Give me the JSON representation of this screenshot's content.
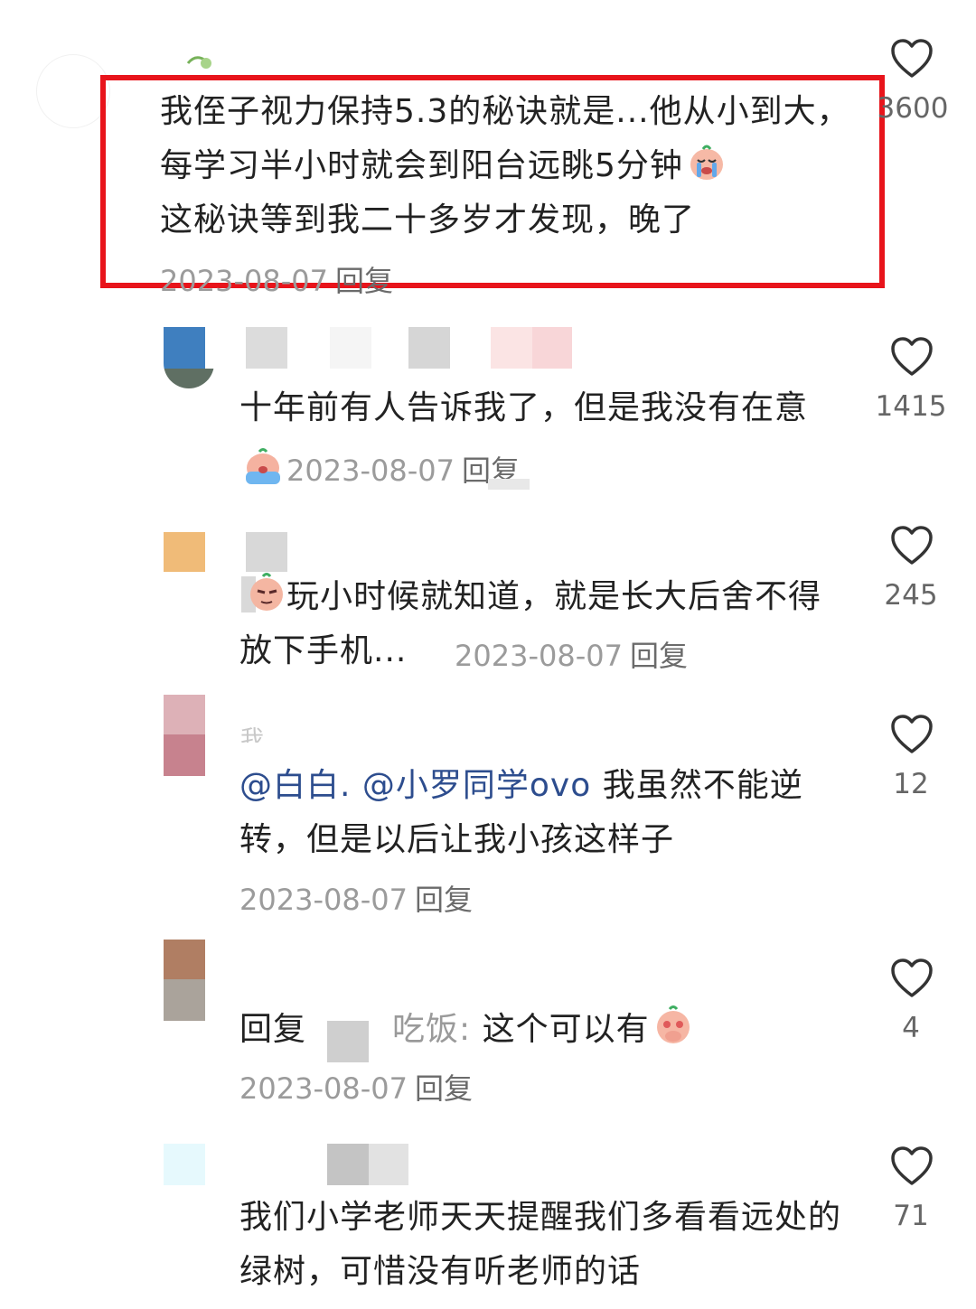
{
  "comments": [
    {
      "text": "我侄子视力保持5.3的秘诀就是...他从小到大，每学习半小时就会到阳台远眺5分钟",
      "text_tail": "这秘诀等到我二十多岁才发现，晚了",
      "date": "2023-08-07",
      "reply_label": "回复",
      "likes": "3600",
      "highlighted": true
    },
    {
      "text": "十年前有人告诉我了，但是我没有在意",
      "date": "2023-08-07",
      "reply_label": "回复",
      "likes": "1415"
    },
    {
      "text": "玩小时候就知道，就是长大后舍不得放下手机...",
      "date": "2023-08-07",
      "reply_label": "回复",
      "likes": "245"
    },
    {
      "username_partial": "我",
      "mention_1": "@白白.",
      "mention_2": "@小罗同学ovo",
      "text": "我虽然不能逆转，但是以后让我小孩这样子",
      "date": "2023-08-07",
      "reply_label": "回复",
      "likes": "12"
    },
    {
      "reply_prefix": "回复",
      "reply_target_suffix": "吃饭:",
      "text": "这个可以有",
      "date": "2023-08-07",
      "reply_label": "回复",
      "likes": "4"
    },
    {
      "text": "我们小学老师天天提醒我们多看看远处的绿树，可惜没有听老师的话",
      "likes": "71"
    }
  ],
  "highlight_color": "#e8141b",
  "mention_color": "#2d4d8e",
  "icons": [
    "heart-outline-icon",
    "crying-emoji-icon",
    "sobbing-emoji-icon",
    "smirk-emoji-icon",
    "shy-emoji-icon"
  ]
}
